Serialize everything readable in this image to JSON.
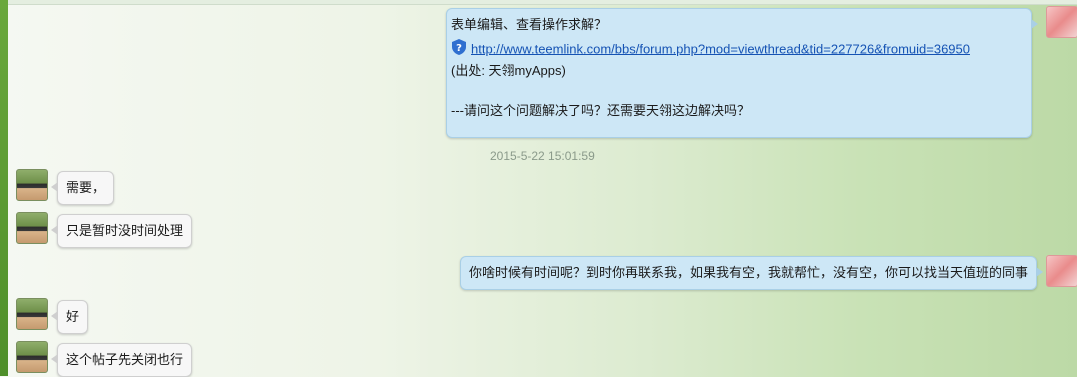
{
  "messages": [
    {
      "side": "out",
      "lines": {
        "title": "表单编辑、查看操作求解？",
        "link": "http://www.teemlink.com/bbs/forum.php?mod=viewthread&tid=227726&fromuid=36950",
        "source": "(出处: 天翎myApps)",
        "question": "---请问这个问题解决了吗？还需要天翎这边解决吗？"
      }
    },
    {
      "side": "in",
      "text": "需要，"
    },
    {
      "side": "in",
      "text": "只是暂时没时间处理"
    },
    {
      "side": "out",
      "text": "你啥时候有时间呢？到时你再联系我，如果我有空，我就帮忙，没有空，你可以找当天值班的同事"
    },
    {
      "side": "in",
      "text": "好"
    },
    {
      "side": "in",
      "text": "这个帖子先关闭也行"
    }
  ],
  "timestamp": "2015-5-22 15:01:59",
  "icons": {
    "link_icon": "shield-question-icon",
    "avatar_me": "avatar-me",
    "avatar_them": "avatar-contact"
  },
  "colors": {
    "out_bubble": "#cde7f6",
    "in_bubble": "#f7f7f7",
    "link": "#1553b4"
  }
}
